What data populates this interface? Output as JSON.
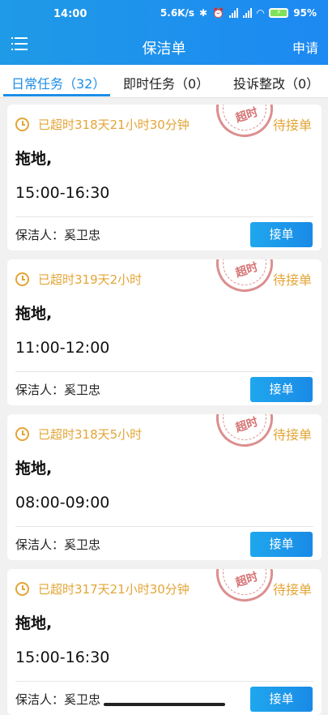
{
  "status_bar": {
    "time": "14:00",
    "network_speed": "5.6K/s",
    "battery": "95%"
  },
  "header": {
    "title": "保洁单",
    "apply_label": "申请"
  },
  "tabs": [
    {
      "label": "日常任务（32）"
    },
    {
      "label": "即时任务（0）"
    },
    {
      "label": "投诉整改（0）"
    }
  ],
  "cards": [
    {
      "status": "已超时318天21小时30分钟",
      "stamp": "超时",
      "state": "待接单",
      "task": "拖地,",
      "time": "15:00-16:30",
      "cleaner": "保洁人：奚卫忠",
      "action": "接单"
    },
    {
      "status": "已超时319天2小时",
      "stamp": "超时",
      "state": "待接单",
      "task": "拖地,",
      "time": "11:00-12:00",
      "cleaner": "保洁人：奚卫忠",
      "action": "接单"
    },
    {
      "status": "已超时318天5小时",
      "stamp": "超时",
      "state": "待接单",
      "task": "拖地,",
      "time": "08:00-09:00",
      "cleaner": "保洁人：奚卫忠",
      "action": "接单"
    },
    {
      "status": "已超时317天21小时30分钟",
      "stamp": "超时",
      "state": "待接单",
      "task": "拖地,",
      "time": "15:00-16:30",
      "cleaner": "保洁人：奚卫忠",
      "action": "接单"
    }
  ],
  "colors": {
    "header": "#1d8de6",
    "warning": "#e3a536",
    "stamp": "#d77c7c",
    "button": "#1a8ae6"
  }
}
